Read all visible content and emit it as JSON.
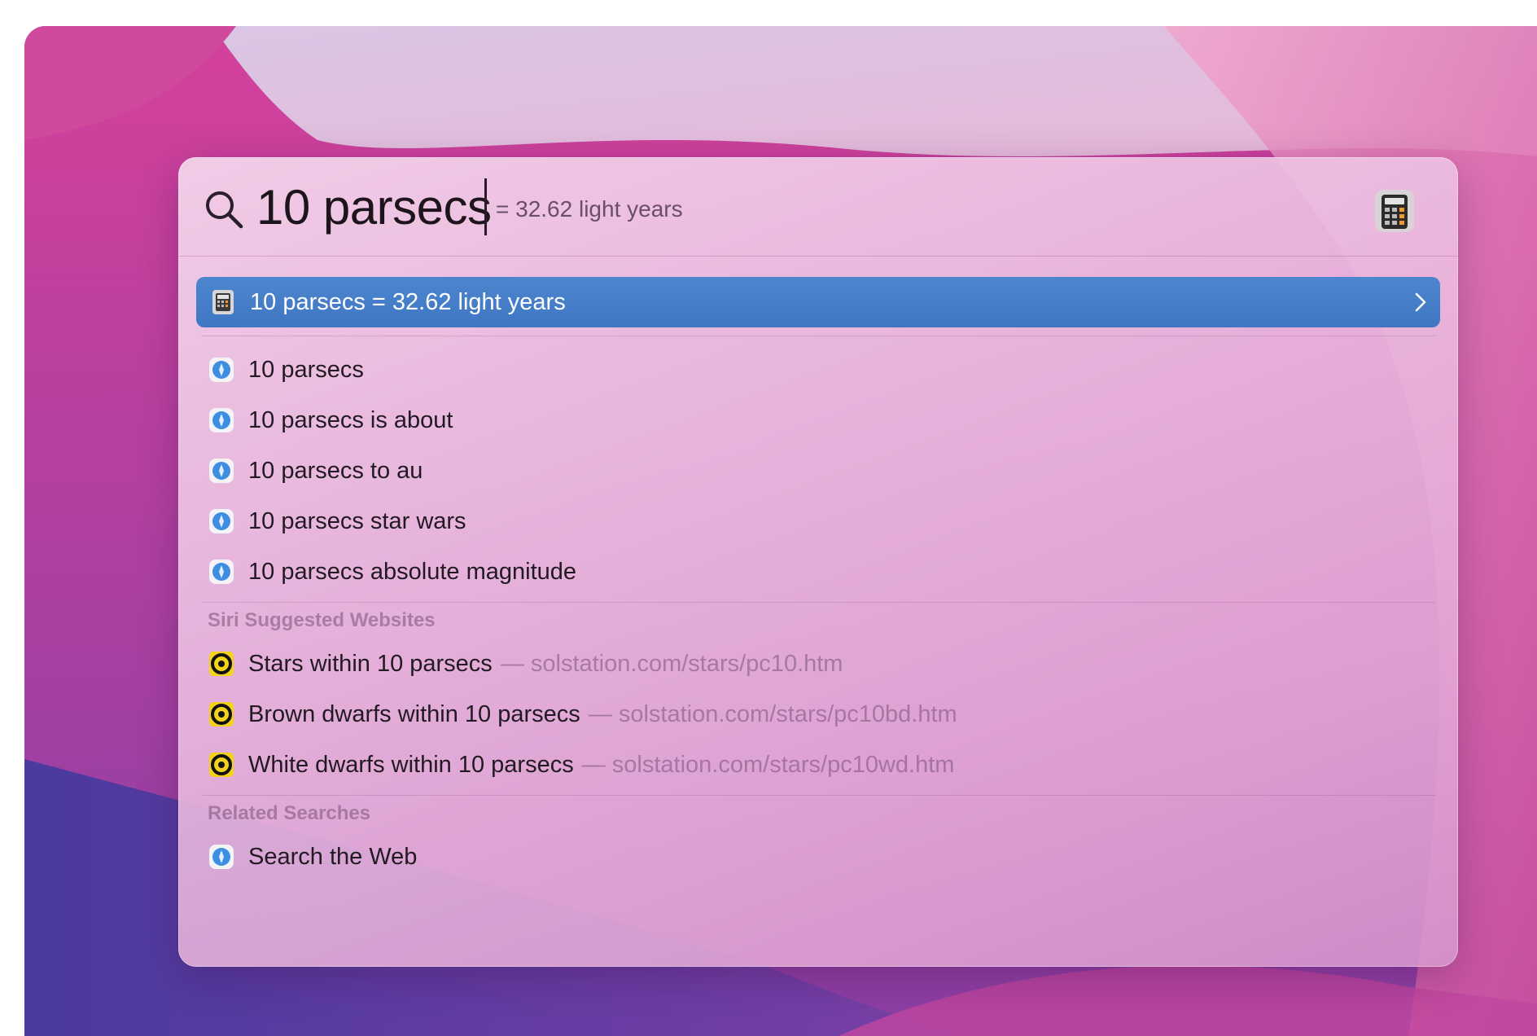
{
  "search": {
    "query": "10 parsecs",
    "inline_result": "= 32.62 light years"
  },
  "top_hit": {
    "label": "10 parsecs = 32.62 light years",
    "icon": "calculator-icon"
  },
  "suggestions": [
    {
      "label": "10 parsecs",
      "icon": "safari-icon"
    },
    {
      "label": "10 parsecs is about",
      "icon": "safari-icon"
    },
    {
      "label": "10 parsecs to au",
      "icon": "safari-icon"
    },
    {
      "label": "10 parsecs star wars",
      "icon": "safari-icon"
    },
    {
      "label": "10 parsecs absolute magnitude",
      "icon": "safari-icon"
    }
  ],
  "siri_websites": {
    "title": "Siri Suggested Websites",
    "items": [
      {
        "label": "Stars within 10 parsecs",
        "url": "— solstation.com/stars/pc10.htm",
        "icon": "solstation-icon"
      },
      {
        "label": "Brown dwarfs within 10 parsecs",
        "url": "— solstation.com/stars/pc10bd.htm",
        "icon": "solstation-icon"
      },
      {
        "label": "White dwarfs within 10 parsecs",
        "url": "— solstation.com/stars/pc10wd.htm",
        "icon": "solstation-icon"
      }
    ]
  },
  "related": {
    "title": "Related Searches",
    "items": [
      {
        "label": "Search the Web",
        "icon": "safari-icon"
      }
    ]
  },
  "colors": {
    "selection": "#4a82cc",
    "site_icon": "#f2d21a"
  }
}
